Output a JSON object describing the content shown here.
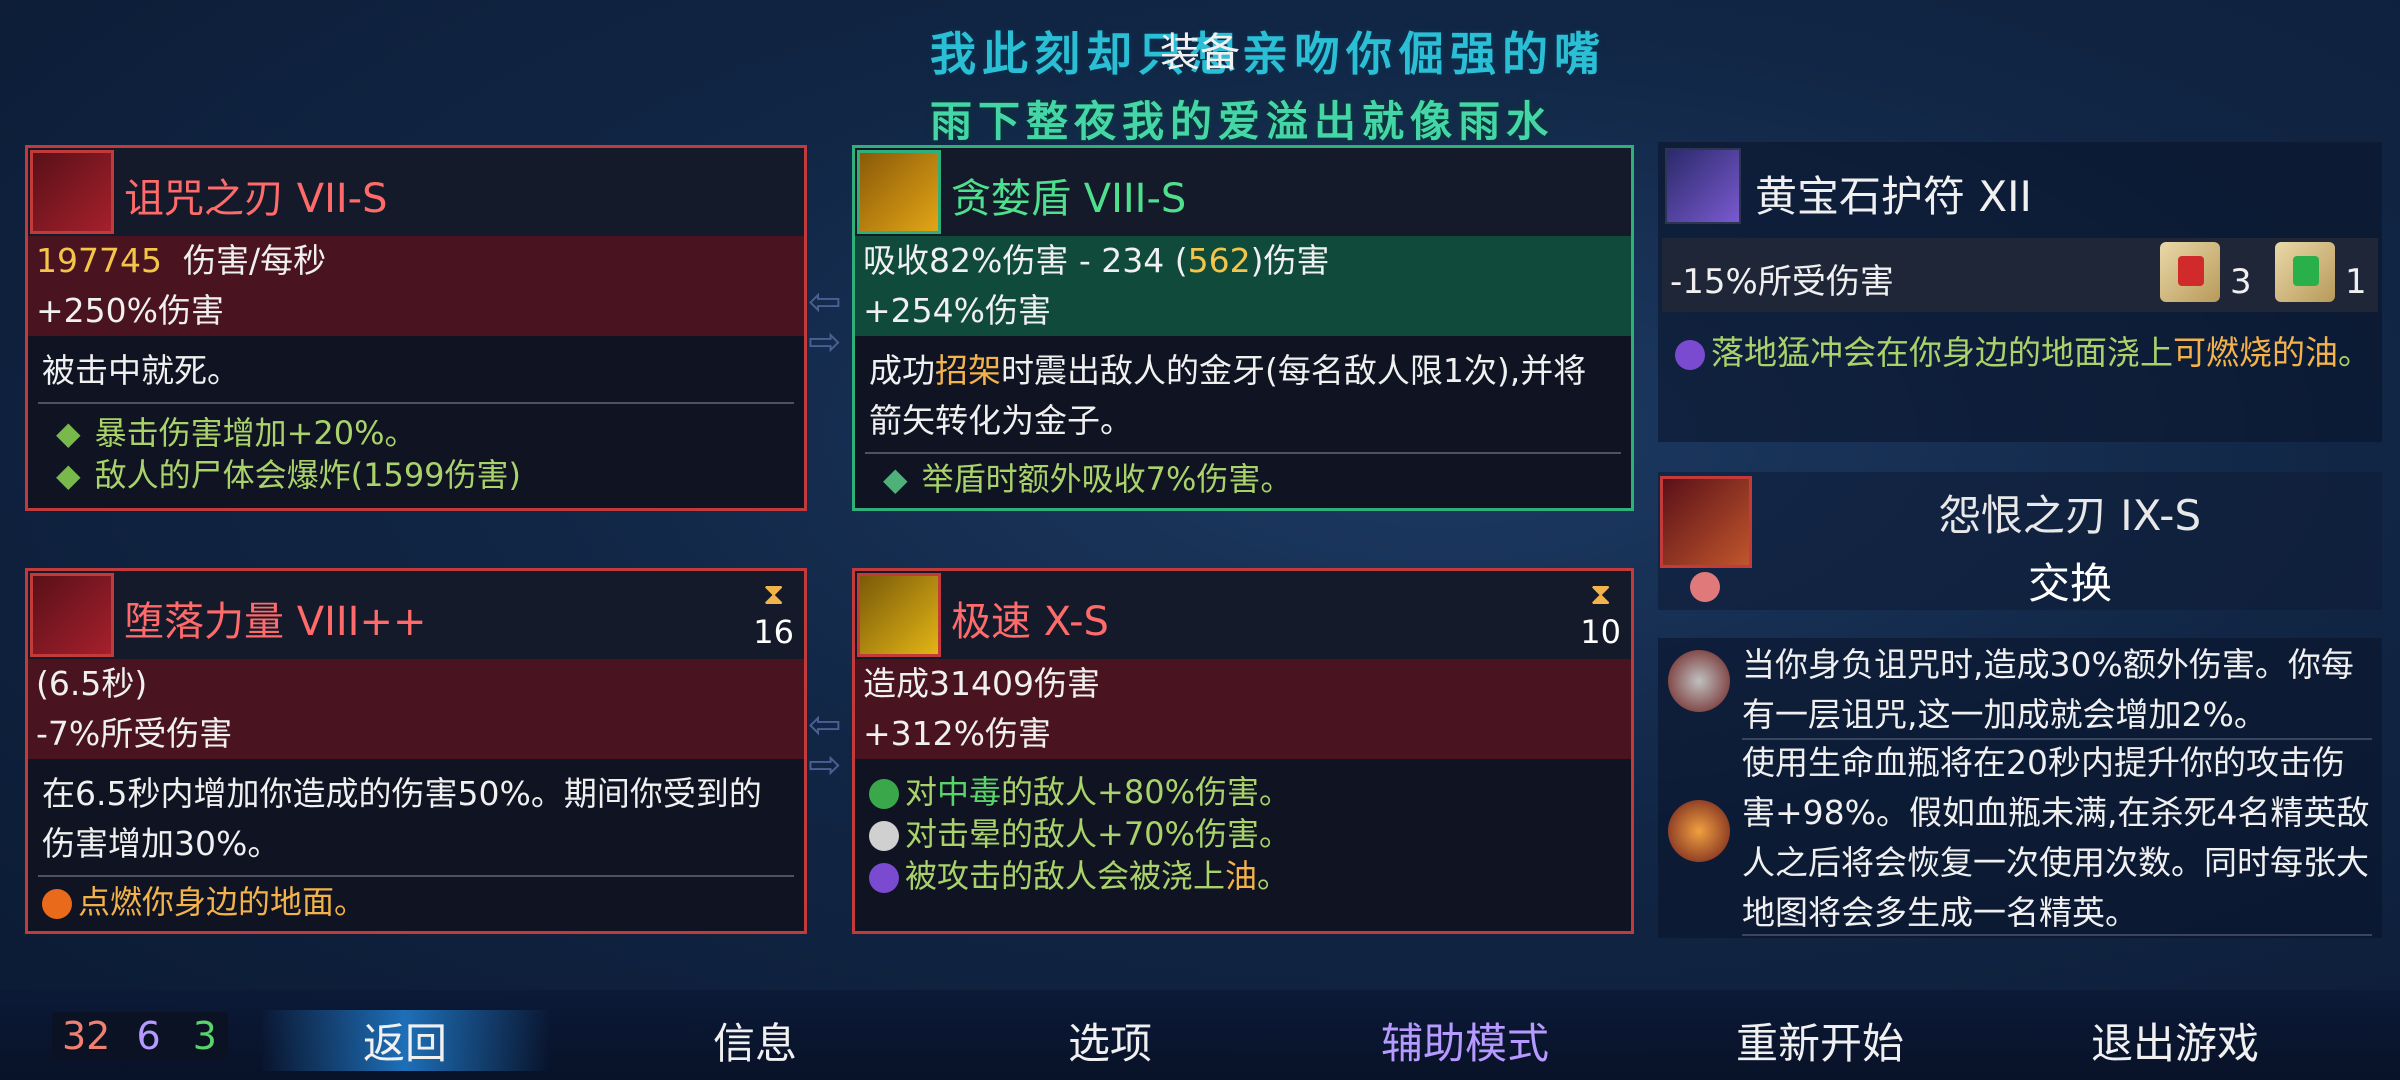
{
  "overlay_lyrics": [
    "我此刻却只想亲吻你倔强的嘴",
    "雨下整夜我的爱溢出就像雨水"
  ],
  "screen_title": "装备",
  "cards": {
    "curse_blade": {
      "name": "诅咒之刃 VII-S",
      "dps_value": "197745",
      "dps_label": "伤害/每秒",
      "bonus": "+250%伤害",
      "desc": "被击中就死。",
      "bullets": [
        "暴击伤害增加+20%。",
        "敌人的尸体会爆炸(1599伤害)"
      ]
    },
    "greed_shield": {
      "name": "贪婪盾 VIII-S",
      "stat_prefix": "吸收82%伤害 - 234 (",
      "stat_value": "562",
      "stat_suffix": ")伤害",
      "bonus": "+254%伤害",
      "desc_prefix": "成功",
      "desc_highlight": "招架",
      "desc_suffix": "时震出敌人的金牙(每名敌人限1次),并将箭矢转化为金子。",
      "bullet": "举盾时额外吸收7%伤害。"
    },
    "fallen_power": {
      "name": "堕落力量 VIII++",
      "cooldown": "16",
      "duration": "(6.5秒)",
      "stat": "-7%所受伤害",
      "desc": "在6.5秒内增加你造成的伤害50%。期间你受到的伤害增加30%。",
      "bullet_highlight": "点燃",
      "bullet_suffix": "你身边的地面。"
    },
    "haste": {
      "name": "极速 X-S",
      "cooldown": "10",
      "stat": "造成31409伤害",
      "bonus": "+312%伤害",
      "bullets": [
        {
          "prefix": "对",
          "highlight": "中毒",
          "suffix": "的敌人+80%伤害。"
        },
        {
          "prefix": "对击晕的敌人+70%伤害。",
          "highlight": "",
          "suffix": ""
        },
        {
          "prefix": "被攻击的敌人会被浇上",
          "highlight": "油",
          "suffix": "。"
        }
      ]
    }
  },
  "amulet": {
    "name": "黄宝石护符 XII",
    "stat": "-15%所受伤害",
    "scroll_counts": [
      "3",
      "1"
    ],
    "desc_prefix": "落地猛冲会在你身边的地面浇上",
    "desc_highlight": "可燃烧的油",
    "desc_suffix": "。"
  },
  "swap_item": {
    "name": "怨恨之刃 IX-S",
    "action": "交换"
  },
  "mutations": [
    "当你身负诅咒时,造成30%额外伤害。你每有一层诅咒,这一加成就会增加2%。",
    "使用生命血瓶将在20秒内提升你的攻击伤害+98%。假如血瓶未满,在杀死4名精英敌人之后将会恢复一次使用次数。同时每张大地图将会多生成一名精英。"
  ],
  "scroll_stats": {
    "red": "32",
    "purple": "6",
    "green": "3"
  },
  "menu": [
    "返回",
    "信息",
    "选项",
    "辅助模式",
    "重新开始",
    "退出游戏"
  ],
  "colors": {
    "red_accent": "#c23a3a",
    "green_accent": "#2fb07a",
    "assist_purple": "#b79aff"
  }
}
